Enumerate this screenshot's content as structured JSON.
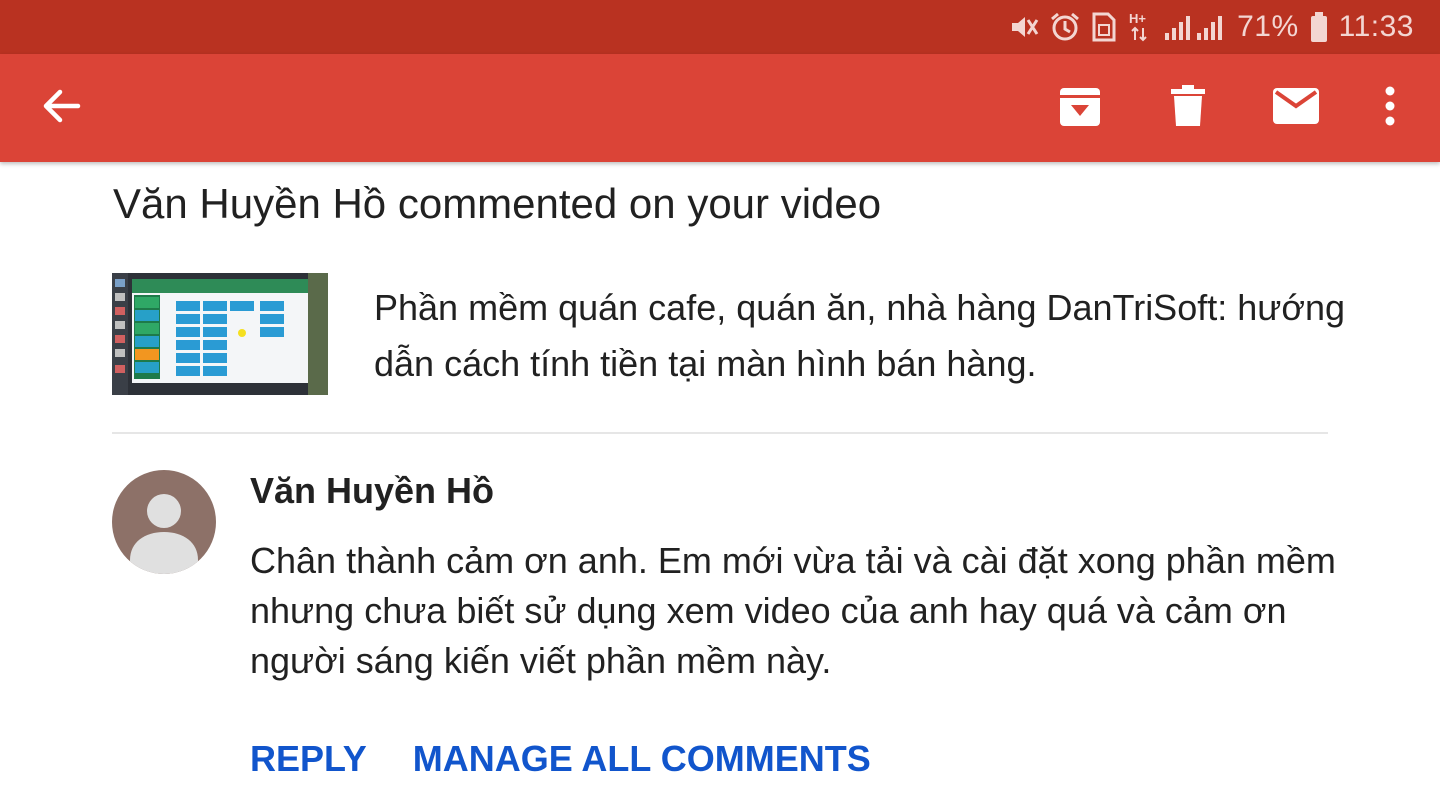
{
  "status_bar": {
    "battery_percent": "71%",
    "time": "11:33",
    "network_type": "H+",
    "icons": [
      "mute-vibrate-icon",
      "alarm-icon",
      "sim-card-icon",
      "data-arrows-icon",
      "signal-icon",
      "battery-icon"
    ]
  },
  "app_bar": {
    "background": "#db4437",
    "icons": [
      "back-arrow-icon",
      "archive-icon",
      "delete-icon",
      "mail-icon",
      "more-vert-icon"
    ]
  },
  "email": {
    "title": "Văn Huyền Hồ commented on your video",
    "video_title": "Phần mềm quán cafe, quán ăn, nhà hàng DanTriSoft: hướng dẫn cách tính tiền tại màn hình bán hàng.",
    "comment": {
      "author": "Văn Huyền Hồ",
      "text": "Chân thành cảm ơn anh. Em mới vừa tải và cài đặt xong phần mềm nhưng chưa biết sử dụng xem video của anh hay quá và cảm ơn người sáng kiến viết phần mềm này."
    },
    "actions": {
      "reply": "REPLY",
      "manage": "MANAGE ALL COMMENTS"
    },
    "link_color": "#1155cc"
  }
}
